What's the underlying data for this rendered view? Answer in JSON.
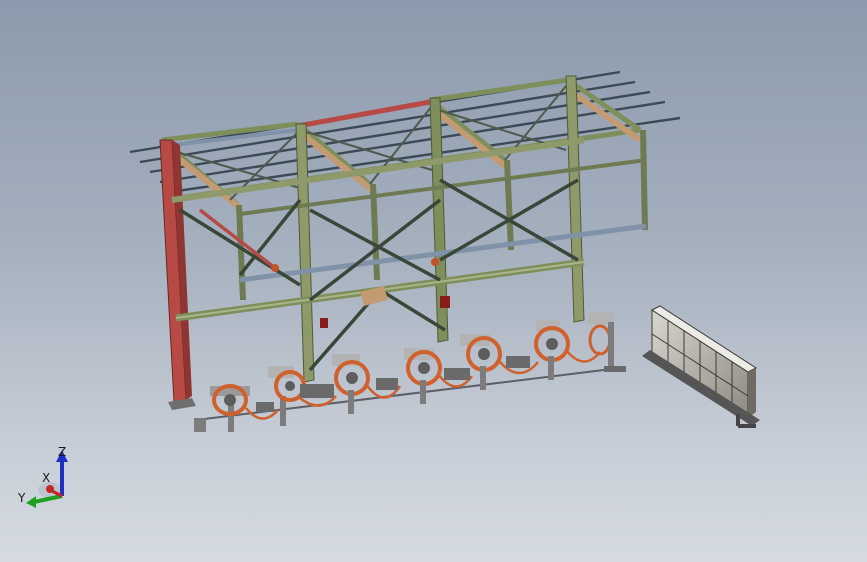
{
  "colors": {
    "background_top": "#8c9aad",
    "background_bottom": "#d6dbe2",
    "frame_red": "#b74a45",
    "frame_green": "#7f8f5c",
    "frame_olive": "#8e9a6a",
    "beam_blue": "#7f92a8",
    "beam_tan": "#c49a72",
    "hose_orange": "#d0612c",
    "axis_x": "#d02020",
    "axis_y": "#20a020",
    "axis_z": "#2030c0"
  },
  "triad": {
    "x_label": "X",
    "y_label": "Y",
    "z_label": "Z"
  },
  "model": {
    "icons": [
      "frame-structure-icon",
      "hose-reel-icon",
      "control-cabinet-icon"
    ]
  }
}
